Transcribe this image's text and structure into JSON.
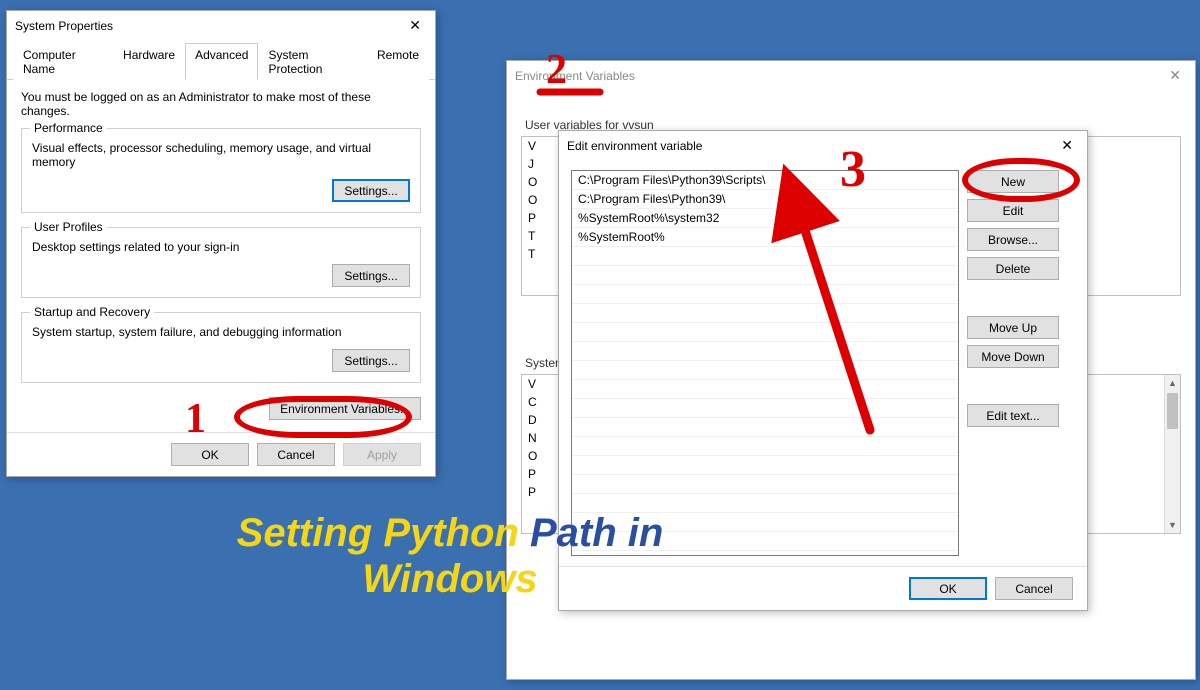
{
  "sysprops": {
    "title": "System Properties",
    "tabs": [
      "Computer Name",
      "Hardware",
      "Advanced",
      "System Protection",
      "Remote"
    ],
    "active_tab": "Advanced",
    "admin_note": "You must be logged on as an Administrator to make most of these changes.",
    "perf": {
      "legend": "Performance",
      "desc": "Visual effects, processor scheduling, memory usage, and virtual memory",
      "btn": "Settings..."
    },
    "profiles": {
      "legend": "User Profiles",
      "desc": "Desktop settings related to your sign-in",
      "btn": "Settings..."
    },
    "startup": {
      "legend": "Startup and Recovery",
      "desc": "System startup, system failure, and debugging information",
      "btn": "Settings..."
    },
    "envbtn": "Environment Variables...",
    "ok": "OK",
    "cancel": "Cancel",
    "apply": "Apply"
  },
  "envvars": {
    "title": "Environment Variables",
    "user_section": "User variables for vvsun",
    "sys_section": "System variables",
    "user_frag": [
      "V",
      "J",
      "O",
      "O",
      "P",
      "T",
      "T"
    ],
    "sys_frag": [
      "V",
      "C",
      "D",
      "N",
      "O",
      "P",
      "P"
    ]
  },
  "editdlg": {
    "title": "Edit environment variable",
    "items": [
      "C:\\Program Files\\Python39\\Scripts\\",
      "C:\\Program Files\\Python39\\",
      "%SystemRoot%\\system32",
      "%SystemRoot%"
    ],
    "btns": {
      "new": "New",
      "edit": "Edit",
      "browse": "Browse...",
      "delete": "Delete",
      "moveup": "Move Up",
      "movedown": "Move Down",
      "edittext": "Edit text..."
    },
    "ok": "OK",
    "cancel": "Cancel"
  },
  "annotations": {
    "n1": "1",
    "n2": "2",
    "n3": "3",
    "caption_line1_a": "Setting Python ",
    "caption_line1_b": "Path in",
    "caption_line2": "Windows"
  }
}
